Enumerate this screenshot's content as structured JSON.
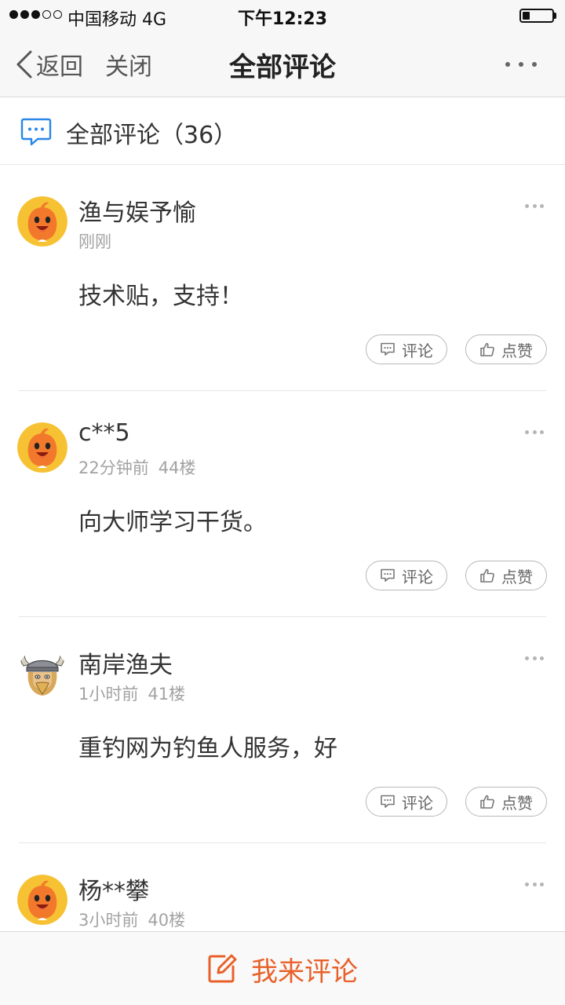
{
  "status_bar": {
    "signal_dots": [
      true,
      true,
      true,
      false,
      false
    ],
    "carrier": "中国移动 4G",
    "time": "下午12:23",
    "battery_level": 0.25
  },
  "nav": {
    "back_label": "返回",
    "close_label": "关闭",
    "title": "全部评论",
    "more_icon": "more-dots-icon"
  },
  "comments_header": {
    "icon": "comment-bubble-icon",
    "title": "全部评论（36）"
  },
  "comments": [
    {
      "username": "渔与娱予愉",
      "time": "刚刚",
      "floor": "",
      "text": "技术贴，支持！",
      "avatar": "orange-mascot"
    },
    {
      "username": "c**5",
      "time": "22分钟前",
      "floor": "44楼",
      "text": "向大师学习干货。",
      "avatar": "orange-mascot"
    },
    {
      "username": "南岸渔夫",
      "time": "1小时前",
      "floor": "41楼",
      "text": "重钓网为钓鱼人服务，好",
      "avatar": "viking-cartoon"
    },
    {
      "username": "杨**攀",
      "time": "3小时前",
      "floor": "40楼",
      "text": "",
      "avatar": "orange-mascot"
    }
  ],
  "actions": {
    "reply_label": "评论",
    "like_label": "点赞"
  },
  "bottom_bar": {
    "write_label": "我来评论",
    "accent_color": "#e8612a"
  },
  "colors": {
    "icon_blue": "#2a86e8",
    "mascot_orange": "#f2792c",
    "mascot_yellow": "#f6c234"
  }
}
